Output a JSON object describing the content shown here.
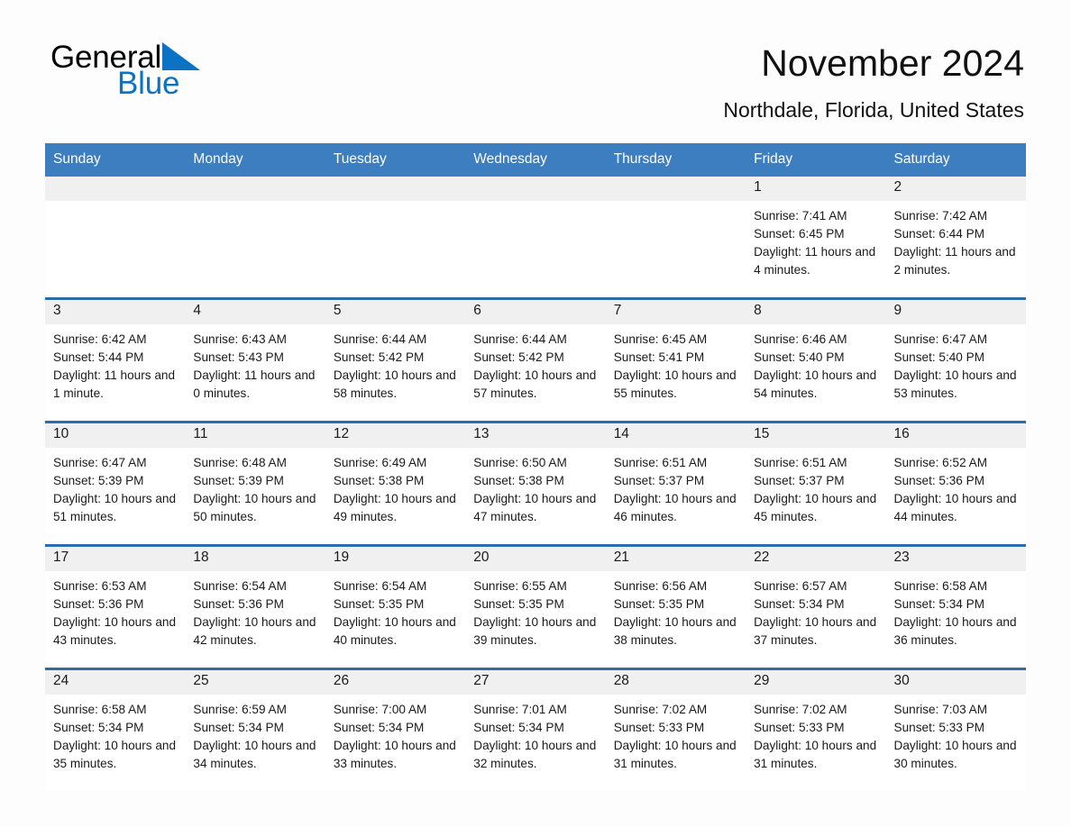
{
  "logo": {
    "word1": "General",
    "word2": "Blue",
    "triangle_color": "#0b72c4"
  },
  "header": {
    "title": "November 2024",
    "subtitle": "Northdale, Florida, United States"
  },
  "theme": {
    "header_blue": "#3c7ebf",
    "row_divider_blue": "#2b6cad",
    "daynum_band": "#f0f0f0",
    "text": "#1a1a1a",
    "page_background": "#fdfdfd"
  },
  "weekday_headers": [
    "Sunday",
    "Monday",
    "Tuesday",
    "Wednesday",
    "Thursday",
    "Friday",
    "Saturday"
  ],
  "labels": {
    "sunrise_prefix": "Sunrise:",
    "sunset_prefix": "Sunset:",
    "daylight_prefix": "Daylight:"
  },
  "weeks": [
    [
      {
        "day": "",
        "sunrise": "",
        "sunset": "",
        "daylight": "",
        "empty": true
      },
      {
        "day": "",
        "sunrise": "",
        "sunset": "",
        "daylight": "",
        "empty": true
      },
      {
        "day": "",
        "sunrise": "",
        "sunset": "",
        "daylight": "",
        "empty": true
      },
      {
        "day": "",
        "sunrise": "",
        "sunset": "",
        "daylight": "",
        "empty": true
      },
      {
        "day": "",
        "sunrise": "",
        "sunset": "",
        "daylight": "",
        "empty": true
      },
      {
        "day": "1",
        "sunrise": "Sunrise: 7:41 AM",
        "sunset": "Sunset: 6:45 PM",
        "daylight": "Daylight: 11 hours and 4 minutes.",
        "empty": false
      },
      {
        "day": "2",
        "sunrise": "Sunrise: 7:42 AM",
        "sunset": "Sunset: 6:44 PM",
        "daylight": "Daylight: 11 hours and 2 minutes.",
        "empty": false
      }
    ],
    [
      {
        "day": "3",
        "sunrise": "Sunrise: 6:42 AM",
        "sunset": "Sunset: 5:44 PM",
        "daylight": "Daylight: 11 hours and 1 minute.",
        "empty": false
      },
      {
        "day": "4",
        "sunrise": "Sunrise: 6:43 AM",
        "sunset": "Sunset: 5:43 PM",
        "daylight": "Daylight: 11 hours and 0 minutes.",
        "empty": false
      },
      {
        "day": "5",
        "sunrise": "Sunrise: 6:44 AM",
        "sunset": "Sunset: 5:42 PM",
        "daylight": "Daylight: 10 hours and 58 minutes.",
        "empty": false
      },
      {
        "day": "6",
        "sunrise": "Sunrise: 6:44 AM",
        "sunset": "Sunset: 5:42 PM",
        "daylight": "Daylight: 10 hours and 57 minutes.",
        "empty": false
      },
      {
        "day": "7",
        "sunrise": "Sunrise: 6:45 AM",
        "sunset": "Sunset: 5:41 PM",
        "daylight": "Daylight: 10 hours and 55 minutes.",
        "empty": false
      },
      {
        "day": "8",
        "sunrise": "Sunrise: 6:46 AM",
        "sunset": "Sunset: 5:40 PM",
        "daylight": "Daylight: 10 hours and 54 minutes.",
        "empty": false
      },
      {
        "day": "9",
        "sunrise": "Sunrise: 6:47 AM",
        "sunset": "Sunset: 5:40 PM",
        "daylight": "Daylight: 10 hours and 53 minutes.",
        "empty": false
      }
    ],
    [
      {
        "day": "10",
        "sunrise": "Sunrise: 6:47 AM",
        "sunset": "Sunset: 5:39 PM",
        "daylight": "Daylight: 10 hours and 51 minutes.",
        "empty": false
      },
      {
        "day": "11",
        "sunrise": "Sunrise: 6:48 AM",
        "sunset": "Sunset: 5:39 PM",
        "daylight": "Daylight: 10 hours and 50 minutes.",
        "empty": false
      },
      {
        "day": "12",
        "sunrise": "Sunrise: 6:49 AM",
        "sunset": "Sunset: 5:38 PM",
        "daylight": "Daylight: 10 hours and 49 minutes.",
        "empty": false
      },
      {
        "day": "13",
        "sunrise": "Sunrise: 6:50 AM",
        "sunset": "Sunset: 5:38 PM",
        "daylight": "Daylight: 10 hours and 47 minutes.",
        "empty": false
      },
      {
        "day": "14",
        "sunrise": "Sunrise: 6:51 AM",
        "sunset": "Sunset: 5:37 PM",
        "daylight": "Daylight: 10 hours and 46 minutes.",
        "empty": false
      },
      {
        "day": "15",
        "sunrise": "Sunrise: 6:51 AM",
        "sunset": "Sunset: 5:37 PM",
        "daylight": "Daylight: 10 hours and 45 minutes.",
        "empty": false
      },
      {
        "day": "16",
        "sunrise": "Sunrise: 6:52 AM",
        "sunset": "Sunset: 5:36 PM",
        "daylight": "Daylight: 10 hours and 44 minutes.",
        "empty": false
      }
    ],
    [
      {
        "day": "17",
        "sunrise": "Sunrise: 6:53 AM",
        "sunset": "Sunset: 5:36 PM",
        "daylight": "Daylight: 10 hours and 43 minutes.",
        "empty": false
      },
      {
        "day": "18",
        "sunrise": "Sunrise: 6:54 AM",
        "sunset": "Sunset: 5:36 PM",
        "daylight": "Daylight: 10 hours and 42 minutes.",
        "empty": false
      },
      {
        "day": "19",
        "sunrise": "Sunrise: 6:54 AM",
        "sunset": "Sunset: 5:35 PM",
        "daylight": "Daylight: 10 hours and 40 minutes.",
        "empty": false
      },
      {
        "day": "20",
        "sunrise": "Sunrise: 6:55 AM",
        "sunset": "Sunset: 5:35 PM",
        "daylight": "Daylight: 10 hours and 39 minutes.",
        "empty": false
      },
      {
        "day": "21",
        "sunrise": "Sunrise: 6:56 AM",
        "sunset": "Sunset: 5:35 PM",
        "daylight": "Daylight: 10 hours and 38 minutes.",
        "empty": false
      },
      {
        "day": "22",
        "sunrise": "Sunrise: 6:57 AM",
        "sunset": "Sunset: 5:34 PM",
        "daylight": "Daylight: 10 hours and 37 minutes.",
        "empty": false
      },
      {
        "day": "23",
        "sunrise": "Sunrise: 6:58 AM",
        "sunset": "Sunset: 5:34 PM",
        "daylight": "Daylight: 10 hours and 36 minutes.",
        "empty": false
      }
    ],
    [
      {
        "day": "24",
        "sunrise": "Sunrise: 6:58 AM",
        "sunset": "Sunset: 5:34 PM",
        "daylight": "Daylight: 10 hours and 35 minutes.",
        "empty": false
      },
      {
        "day": "25",
        "sunrise": "Sunrise: 6:59 AM",
        "sunset": "Sunset: 5:34 PM",
        "daylight": "Daylight: 10 hours and 34 minutes.",
        "empty": false
      },
      {
        "day": "26",
        "sunrise": "Sunrise: 7:00 AM",
        "sunset": "Sunset: 5:34 PM",
        "daylight": "Daylight: 10 hours and 33 minutes.",
        "empty": false
      },
      {
        "day": "27",
        "sunrise": "Sunrise: 7:01 AM",
        "sunset": "Sunset: 5:34 PM",
        "daylight": "Daylight: 10 hours and 32 minutes.",
        "empty": false
      },
      {
        "day": "28",
        "sunrise": "Sunrise: 7:02 AM",
        "sunset": "Sunset: 5:33 PM",
        "daylight": "Daylight: 10 hours and 31 minutes.",
        "empty": false
      },
      {
        "day": "29",
        "sunrise": "Sunrise: 7:02 AM",
        "sunset": "Sunset: 5:33 PM",
        "daylight": "Daylight: 10 hours and 31 minutes.",
        "empty": false
      },
      {
        "day": "30",
        "sunrise": "Sunrise: 7:03 AM",
        "sunset": "Sunset: 5:33 PM",
        "daylight": "Daylight: 10 hours and 30 minutes.",
        "empty": false
      }
    ]
  ]
}
